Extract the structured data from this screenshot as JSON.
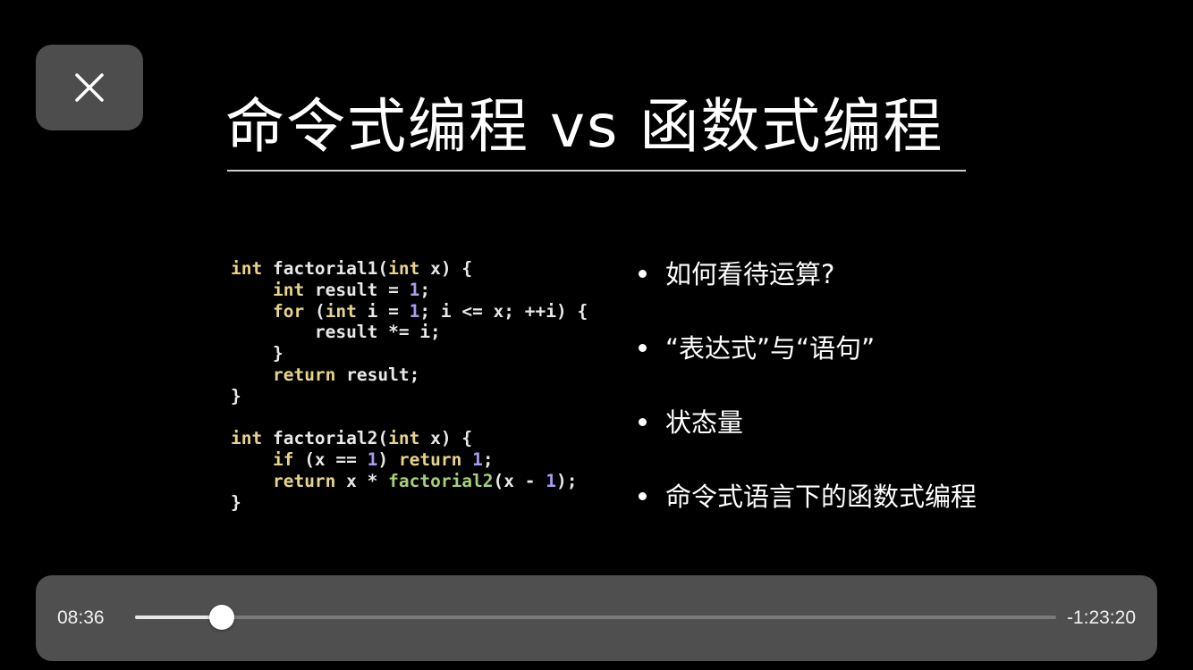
{
  "slide": {
    "title": "命令式编程 vs 函数式编程",
    "code_lines": [
      [
        {
          "t": "int",
          "c": "kw"
        },
        {
          "t": " factorial1("
        },
        {
          "t": "int",
          "c": "kw"
        },
        {
          "t": " x) {"
        }
      ],
      [
        {
          "t": "    "
        },
        {
          "t": "int",
          "c": "kw"
        },
        {
          "t": " result = "
        },
        {
          "t": "1",
          "c": "num"
        },
        {
          "t": ";"
        }
      ],
      [
        {
          "t": "    "
        },
        {
          "t": "for",
          "c": "kw"
        },
        {
          "t": " ("
        },
        {
          "t": "int",
          "c": "kw"
        },
        {
          "t": " i = "
        },
        {
          "t": "1",
          "c": "num"
        },
        {
          "t": "; i <= x; ++i) {"
        }
      ],
      [
        {
          "t": "        result *= i;"
        }
      ],
      [
        {
          "t": "    }"
        }
      ],
      [
        {
          "t": "    "
        },
        {
          "t": "return",
          "c": "kw"
        },
        {
          "t": " result;"
        }
      ],
      [
        {
          "t": "}"
        }
      ],
      [
        {
          "t": ""
        }
      ],
      [
        {
          "t": "int",
          "c": "kw"
        },
        {
          "t": " factorial2("
        },
        {
          "t": "int",
          "c": "kw"
        },
        {
          "t": " x) {"
        }
      ],
      [
        {
          "t": "    "
        },
        {
          "t": "if",
          "c": "kw"
        },
        {
          "t": " (x == "
        },
        {
          "t": "1",
          "c": "num"
        },
        {
          "t": ") "
        },
        {
          "t": "return",
          "c": "kw"
        },
        {
          "t": " "
        },
        {
          "t": "1",
          "c": "num"
        },
        {
          "t": ";"
        }
      ],
      [
        {
          "t": "    "
        },
        {
          "t": "return",
          "c": "kw"
        },
        {
          "t": " x * "
        },
        {
          "t": "factorial2",
          "c": "fn"
        },
        {
          "t": "(x - "
        },
        {
          "t": "1",
          "c": "num"
        },
        {
          "t": ");"
        }
      ],
      [
        {
          "t": "}"
        }
      ]
    ],
    "bullets": [
      "如何看待运算?",
      "“表达式”与“语句”",
      "状态量",
      "命令式语言下的函数式编程"
    ],
    "code_colors": {
      "keyword": "#e6d48a",
      "number": "#a99cf0",
      "function": "#a6cf7a",
      "text": "#e8e8e8"
    }
  },
  "player": {
    "close_icon": "close-icon",
    "elapsed": "08:36",
    "remaining": "-1:23:20",
    "progress": 0.0944
  }
}
